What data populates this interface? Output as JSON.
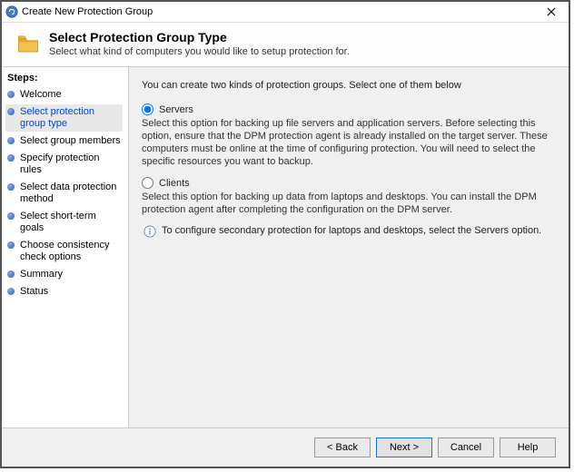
{
  "window": {
    "title": "Create New Protection Group"
  },
  "header": {
    "title": "Select Protection Group Type",
    "subtitle": "Select what kind of computers you would like to setup protection for."
  },
  "sidebar": {
    "title": "Steps:",
    "items": [
      {
        "label": "Welcome"
      },
      {
        "label": "Select protection group type"
      },
      {
        "label": "Select group members"
      },
      {
        "label": "Specify protection rules"
      },
      {
        "label": "Select data protection method"
      },
      {
        "label": "Select short-term goals"
      },
      {
        "label": "Choose consistency check options"
      },
      {
        "label": "Summary"
      },
      {
        "label": "Status"
      }
    ],
    "active_index": 1
  },
  "main": {
    "intro": "You can create two kinds of protection groups. Select one of them below",
    "options": [
      {
        "id": "servers",
        "label": "Servers",
        "checked": true,
        "description": "Select this option for backing up file servers and application servers. Before selecting this option, ensure that the DPM protection agent is already installed on the target server. These computers must be online at the time of configuring protection. You will need to select the specific resources you want to backup."
      },
      {
        "id": "clients",
        "label": "Clients",
        "checked": false,
        "description": "Select this option for backing up data from laptops and desktops. You can install the DPM protection agent after completing the configuration on the DPM server."
      }
    ],
    "info": "To configure secondary protection for laptops and desktops, select the Servers option."
  },
  "footer": {
    "back": "< Back",
    "next": "Next >",
    "cancel": "Cancel",
    "help": "Help"
  }
}
